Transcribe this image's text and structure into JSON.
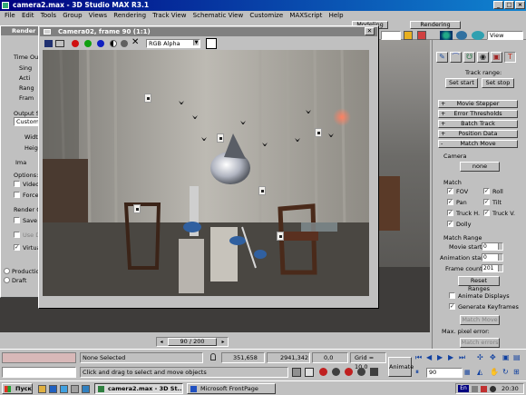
{
  "app": {
    "title": "camera2.max - 3D Studio MAX R3.1",
    "controls": [
      "_",
      "□",
      "×"
    ]
  },
  "menu": [
    "File",
    "Edit",
    "Tools",
    "Group",
    "Views",
    "Rendering",
    "Track View",
    "Schematic View",
    "Customize",
    "MAXScript",
    "Help"
  ],
  "toolbar": {
    "tab_modeling": "Modeling",
    "tab_rendering": "Rendering",
    "view_select": "View"
  },
  "render_panel": {
    "title": "Render S",
    "time_output": "Time Outpu",
    "opt_single": "Sing",
    "opt_active": "Acti",
    "opt_range": "Rang",
    "opt_frames": "Fram",
    "output_size": "Output Si",
    "size_select": "Custom",
    "width": "Widt",
    "height": "Heigh",
    "image_aspect": "Ima",
    "options": "Options:",
    "video": "Video",
    "force": "Force",
    "render_output": "Render O",
    "save_file": "Save F",
    "use_device": "Use D",
    "virtual": "Virtual",
    "production": "Production",
    "draft": "Draft"
  },
  "camwin": {
    "title": "Camera02, frame 90 (1:1)",
    "channel": "RGB Alpha",
    "close": "✕"
  },
  "cmdpanel": {
    "track_range": "Track range:",
    "set_start": "Set start",
    "set_stop": "Set stop",
    "rollouts": [
      {
        "sign": "+",
        "label": "Movie Stepper"
      },
      {
        "sign": "+",
        "label": "Error Thresholds"
      },
      {
        "sign": "+",
        "label": "Batch Track"
      },
      {
        "sign": "+",
        "label": "Position Data"
      },
      {
        "sign": "-",
        "label": "Match Move"
      }
    ],
    "camera_label": "Camera",
    "camera_btn": "none",
    "match_label": "Match",
    "fov": "FOV",
    "roll": "Roll",
    "pan": "Pan",
    "tilt": "Tilt",
    "truck_h": "Truck H.",
    "truck_v": "Truck V.",
    "dolly": "Dolly",
    "match_range": "Match Range",
    "movie_start_label": "Movie start:",
    "movie_start": "0",
    "anim_start_label": "Animation start:",
    "anim_start": "0",
    "frame_count_label": "Frame count:",
    "frame_count": "201",
    "reset_ranges": "Reset Ranges",
    "animate_displays": "Animate Displays",
    "generate_keyframes": "Generate Keyframes",
    "match_move_btn": "Match Move",
    "max_pixel_error": "Max. pixel error:",
    "match_errors_btn": "Match errors"
  },
  "timeslider": {
    "value": "90 / 200"
  },
  "status": {
    "selection": "None Selected",
    "x": "351,658",
    "y": "2941,342",
    "z": "0,0",
    "grid": "Grid = 10,0",
    "animate": "Animate",
    "prompt": "Click and drag to select and move objects",
    "frame": "90"
  },
  "taskbar": {
    "start": "Пуск",
    "items": [
      "camera2.max - 3D St...",
      "Microsoft FrontPage"
    ],
    "clock": "20:30",
    "lang": "En"
  }
}
